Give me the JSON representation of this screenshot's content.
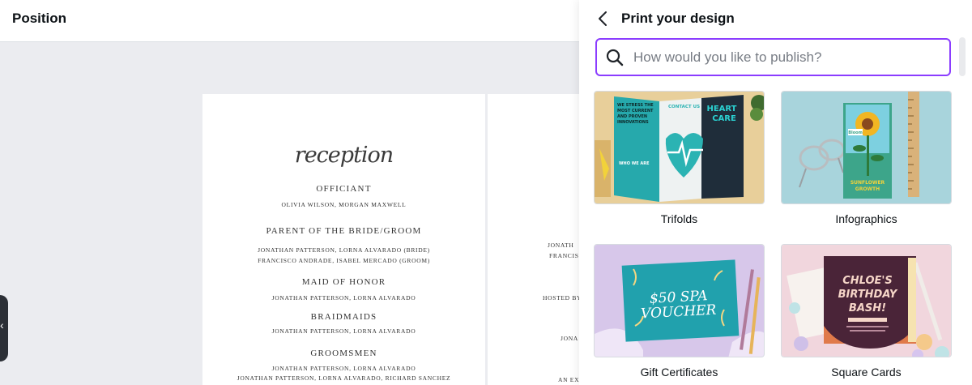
{
  "editor": {
    "title": "Position",
    "page1": {
      "heading": "reception",
      "sections": [
        {
          "role": "OFFICIANT",
          "names": [
            "OLIVIA WILSON, MORGAN MAXWELL"
          ]
        },
        {
          "role": "PARENT OF THE BRIDE/GROOM",
          "names": [
            "JONATHAN PATTERSON, LORNA ALVARADO (BRIDE)",
            "FRANCISCO ANDRADE, ISABEL MERCADO (GROOM)"
          ]
        },
        {
          "role": "MAID OF HONOR",
          "names": [
            "JONATHAN PATTERSON, LORNA ALVARADO"
          ]
        },
        {
          "role": "BRAIDMAIDS",
          "names": [
            "JONATHAN PATTERSON, LORNA ALVARADO"
          ]
        },
        {
          "role": "GROOMSMEN",
          "names": [
            "JONATHAN PATTERSON, LORNA ALVARADO",
            "JONATHAN PATTERSON, LORNA ALVARADO, RICHARD SANCHEZ"
          ]
        }
      ]
    },
    "page2_fragments": [
      "JONATH",
      "FRANCIS",
      "HOSTED BY",
      "JONA",
      "AN EXC"
    ],
    "handle_icon": "chevron-left-icon"
  },
  "panel": {
    "title": "Print your design",
    "back_icon": "chevron-left-icon",
    "search": {
      "placeholder": "How would you like to publish?",
      "value": "",
      "icon": "search-icon"
    },
    "accent_color": "#8b3dff",
    "cards": [
      {
        "label": "Trifolds"
      },
      {
        "label": "Infographics"
      },
      {
        "label": "Gift Certificates"
      },
      {
        "label": "Square Cards"
      }
    ],
    "thumbnails": {
      "trifold": {
        "left_text": "WE STRESS THE MOST CURRENT AND PROVEN INNOVATIONS",
        "mid_text": "CONTACT US",
        "right_text": "HEART CARE",
        "bottom_text": "WHO WE ARE"
      },
      "infographic": {
        "badge": "Bloom",
        "text": "SUNFLOWER GROWTH"
      },
      "gift": {
        "line1": "$50 SPA",
        "line2": "VOUCHER"
      },
      "square": {
        "line1": "CHLOE'S",
        "line2": "BIRTHDAY",
        "line3": "BASH!"
      }
    }
  }
}
